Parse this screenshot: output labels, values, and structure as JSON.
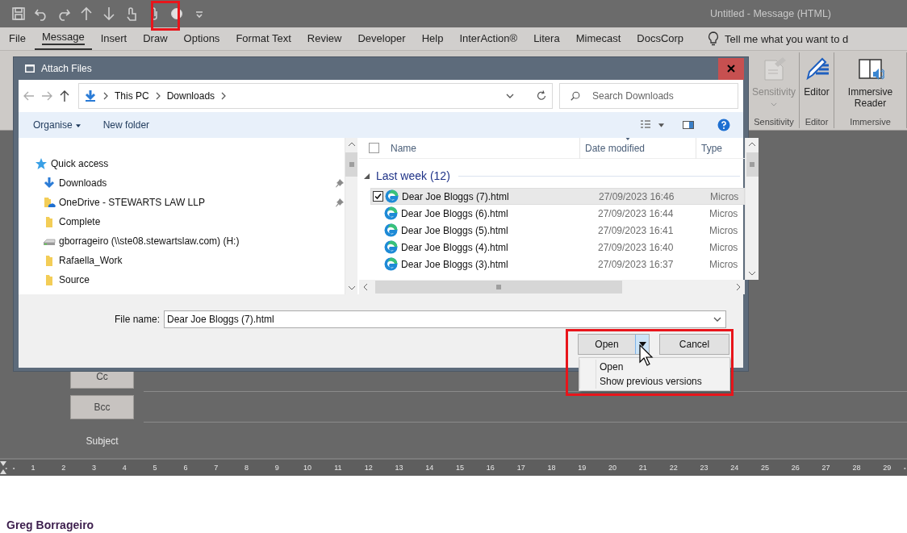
{
  "window": {
    "title": "Untitled  -  Message (HTML)"
  },
  "ribbon_tabs": [
    {
      "label": "File",
      "selected": false
    },
    {
      "label": "Message",
      "selected": true
    },
    {
      "label": "Insert",
      "selected": false
    },
    {
      "label": "Draw",
      "selected": false
    },
    {
      "label": "Options",
      "selected": false
    },
    {
      "label": "Format Text",
      "selected": false
    },
    {
      "label": "Review",
      "selected": false
    },
    {
      "label": "Developer",
      "selected": false
    },
    {
      "label": "Help",
      "selected": false
    },
    {
      "label": "InterAction®",
      "selected": false
    },
    {
      "label": "Litera",
      "selected": false
    },
    {
      "label": "Mimecast",
      "selected": false
    },
    {
      "label": "DocsCorp",
      "selected": false
    }
  ],
  "tell_me": {
    "text": "Tell me what you want to d"
  },
  "ribbon_groups": [
    {
      "label": "Sensitivity",
      "button": {
        "label": "Sensitivity",
        "disabled": true,
        "has_menu": true
      }
    },
    {
      "label": "Editor",
      "button": {
        "label": "Editor",
        "disabled": false,
        "has_menu": false
      }
    },
    {
      "label": "Immersive",
      "button": {
        "label": "Immersive Reader",
        "disabled": false,
        "has_menu": false
      }
    }
  ],
  "dialog": {
    "title": "Attach Files",
    "path": [
      "This PC",
      "Downloads"
    ],
    "search": {
      "placeholder": "Search Downloads"
    },
    "toolbar": [
      {
        "label": "Organise",
        "has_menu": true
      },
      {
        "label": "New folder",
        "has_menu": false
      }
    ],
    "nav": [
      {
        "label": "Quick access",
        "kind": "star",
        "pinned": false
      },
      {
        "label": "Downloads",
        "kind": "download",
        "pinned": true
      },
      {
        "label": "OneDrive - STEWARTS LAW LLP",
        "kind": "cloud",
        "pinned": true
      },
      {
        "label": "Complete",
        "kind": "folder",
        "pinned": false
      },
      {
        "label": "gborrageiro (\\\\ste08.stewartslaw.com) (H:)",
        "kind": "drive",
        "pinned": false
      },
      {
        "label": "Rafaella_Work",
        "kind": "folder",
        "pinned": false
      },
      {
        "label": "Source",
        "kind": "folder",
        "pinned": false
      }
    ],
    "select_all": {
      "checked": false
    },
    "columns": [
      "Name",
      "Date modified",
      "Type"
    ],
    "group": {
      "label": "Last week (12)",
      "expanded": true
    },
    "files": [
      {
        "name": "Dear Joe Bloggs (7).html",
        "date": "27/09/2023 16:46",
        "type": "Micros",
        "selected": true,
        "checked": true
      },
      {
        "name": "Dear Joe Bloggs (6).html",
        "date": "27/09/2023 16:44",
        "type": "Micros",
        "selected": false,
        "checked": false
      },
      {
        "name": "Dear Joe Bloggs (5).html",
        "date": "27/09/2023 16:41",
        "type": "Micros",
        "selected": false,
        "checked": false
      },
      {
        "name": "Dear Joe Bloggs (4).html",
        "date": "27/09/2023 16:40",
        "type": "Micros",
        "selected": false,
        "checked": false
      },
      {
        "name": "Dear Joe Bloggs (3).html",
        "date": "27/09/2023 16:37",
        "type": "Micros",
        "selected": false,
        "checked": false
      }
    ],
    "file_name": {
      "label": "File name:",
      "value": "Dear Joe Bloggs (7).html"
    },
    "buttons": [
      {
        "label": "Open",
        "kind": "split"
      },
      {
        "label": "Cancel",
        "kind": "plain"
      }
    ],
    "menu": [
      {
        "label": "Open"
      },
      {
        "label": "Show previous versions"
      }
    ]
  },
  "compose": [
    {
      "label": "Cc",
      "kind": "button"
    },
    {
      "label": "Bcc",
      "kind": "button"
    },
    {
      "label": "Subject",
      "kind": "label"
    }
  ],
  "ruler": [
    "1",
    "2",
    "3",
    "4",
    "5",
    "6",
    "7",
    "8",
    "9",
    "10",
    "11",
    "12",
    "13",
    "14",
    "15",
    "16",
    "17",
    "18",
    "19",
    "20",
    "21",
    "22",
    "23",
    "24",
    "25",
    "26",
    "27",
    "28",
    "29"
  ],
  "body": {
    "signature": "Greg Borrageiro"
  }
}
